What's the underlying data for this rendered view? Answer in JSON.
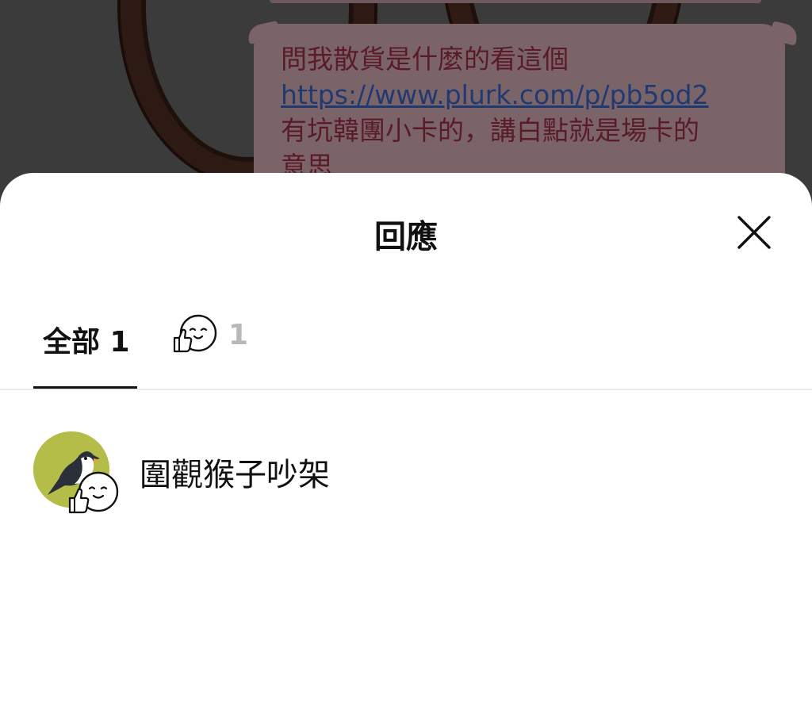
{
  "background_message": {
    "line1": "問我散貨是什麼的看這個",
    "link": "https://www.plurk.com/p/pb5od2",
    "line3": "有坑韓團小卡的，講白點就是場卡的",
    "line4": "意思"
  },
  "sheet": {
    "title": "回應",
    "close_icon": "close-icon"
  },
  "tabs": {
    "all_label": "全部 1",
    "reaction_icon": "thumbs-up-face-icon",
    "reaction_count": "1"
  },
  "reactions": [
    {
      "name": "圍觀猴子吵架",
      "avatar_icon": "bird-avatar",
      "reaction_icon": "thumbs-up-face-icon"
    }
  ],
  "colors": {
    "overlay": "#3b3b3b",
    "avatar_bg": "#b4bd47",
    "tab_active": "#111111",
    "tab_inactive": "#b8b8b8"
  }
}
